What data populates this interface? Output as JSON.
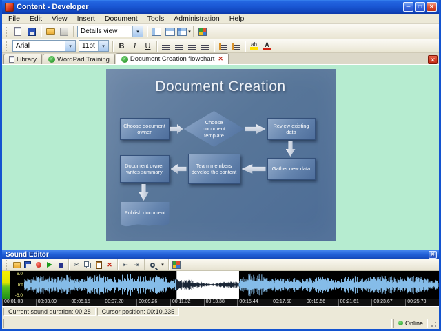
{
  "window": {
    "title": "Content - Developer",
    "menu": [
      "File",
      "Edit",
      "View",
      "Insert",
      "Document",
      "Tools",
      "Administration",
      "Help"
    ]
  },
  "toolbar": {
    "view_mode": "Details view"
  },
  "format_toolbar": {
    "font_family": "Arial",
    "font_size": "11pt",
    "bold": "B",
    "italic": "I",
    "underline": "U"
  },
  "tabs": {
    "library": "Library",
    "wordpad": "WordPad Training",
    "flowchart": "Document Creation flowchart"
  },
  "flowchart": {
    "title": "Document Creation",
    "nodes": [
      {
        "label": "Choose document owner"
      },
      {
        "label": "Choose document template"
      },
      {
        "label": "Review existing data"
      },
      {
        "label": "Document owner writes summary"
      },
      {
        "label": "Team members develop the content"
      },
      {
        "label": "Gather new data"
      },
      {
        "label": "Publish document"
      }
    ]
  },
  "sound_editor": {
    "title": "Sound Editor",
    "scale": {
      "top": "6.0",
      "mid": "-Inf",
      "bottom": "-6.0"
    },
    "timeline": [
      "00:01.03",
      "00:03.09",
      "00:05.15",
      "00:07.20",
      "00:09.26",
      "00:11.32",
      "00:13.38",
      "00:15.44",
      "00:17.50",
      "00:19.56",
      "00:21.61",
      "00:23.67",
      "00:25.73"
    ],
    "selection": {
      "start": 0.367,
      "end": 0.518
    },
    "cursor_frac": 0.382,
    "status": {
      "duration": "Current sound duration: 00:28",
      "cursor": "Cursor position: 00:10.235"
    }
  },
  "status_bar": {
    "online": "Online"
  },
  "icons": {
    "close": "✕",
    "check": "✓",
    "dropdown": "▾",
    "minimize": "─",
    "maximize": "□",
    "cut": "✂",
    "delete": "✕",
    "sel_left": "⇤",
    "sel_right": "⇥"
  }
}
